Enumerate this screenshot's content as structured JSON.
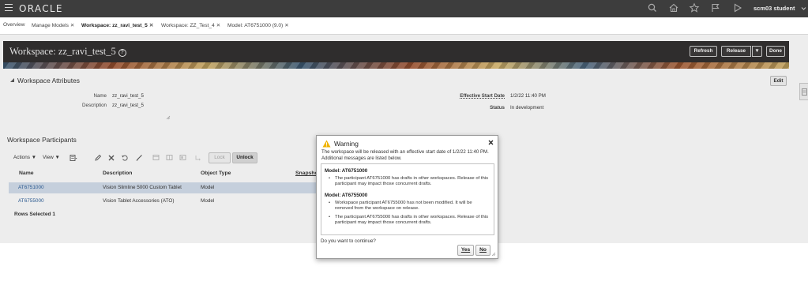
{
  "header": {
    "logo": "ORACLE",
    "user": "scm03 student",
    "icons": [
      "menu-icon",
      "search-icon",
      "home-icon",
      "favorites-icon",
      "notifications-icon",
      "play-icon",
      "user-chevron-icon"
    ]
  },
  "tabs": [
    {
      "label": "Overview",
      "closable": false
    },
    {
      "label": "Manage Models",
      "closable": true
    },
    {
      "label": "Workspace: zz_ravi_test_5",
      "closable": true,
      "active": true
    },
    {
      "label": "Workspace: ZZ_Test_4",
      "closable": true
    },
    {
      "label": "Model: AT6751000 (9.0)",
      "closable": true
    }
  ],
  "titlebar": {
    "title": "Workspace: zz_ravi_test_5",
    "help_glyph": "?",
    "buttons": {
      "refresh": "Refresh",
      "release": "Release",
      "release_menu": "▼",
      "done": "Done"
    }
  },
  "attributes": {
    "section_title": "Workspace Attributes",
    "edit_label": "Edit",
    "name_label": "Name",
    "name_value": "zz_ravi_test_5",
    "description_label": "Description",
    "description_value": "zz_ravi_test_5",
    "effective_start_label": "Effective Start Date",
    "effective_start_value": "1/2/22 11:40 PM",
    "status_label": "Status",
    "status_value": "In development"
  },
  "participants": {
    "section_title": "Workspace Participants",
    "actions_label": "Actions ▼",
    "view_label": "View ▼",
    "lock_label": "Lock",
    "unlock_label": "Unlock",
    "columns": [
      "Name",
      "Description",
      "Object Type",
      "Snapsho"
    ],
    "rows": [
      {
        "name": "AT6751000",
        "description": "Vision Slimline 5000 Custom Tablet",
        "type": "Model",
        "selected": true
      },
      {
        "name": "AT6755000",
        "description": "Vision Tablet Accessories (ATO)",
        "type": "Model",
        "selected": false
      }
    ],
    "rows_selected_label": "Rows Selected",
    "rows_selected_count": "1"
  },
  "dialog": {
    "title": "Warning",
    "message": "The workspace will be released with an effective start date of 1/2/22 11:40 PM. Additional messages are listed below.",
    "groups": [
      {
        "model": "Model: AT6751000",
        "bullets": [
          "The participant AT6751000 has drafts in other workspaces. Release of this participant may impact those concurrent drafts."
        ]
      },
      {
        "model": "Model: AT6755000",
        "bullets": [
          "Workspace participant AT6755000 has not been modified. It will be removed from the workspace on release.",
          "The participant AT6755000 has drafts in other workspaces. Release of this participant may impact those concurrent drafts."
        ]
      }
    ],
    "question": "Do you want to continue?",
    "yes_label": "Yes",
    "no_label": "No"
  },
  "colors": {
    "header_bg": "#3d3d3d",
    "titlebar_bg": "#2f2c2c",
    "selected_row": "#d4dfed",
    "link": "#2a5d99",
    "warning": "#f0b400"
  }
}
